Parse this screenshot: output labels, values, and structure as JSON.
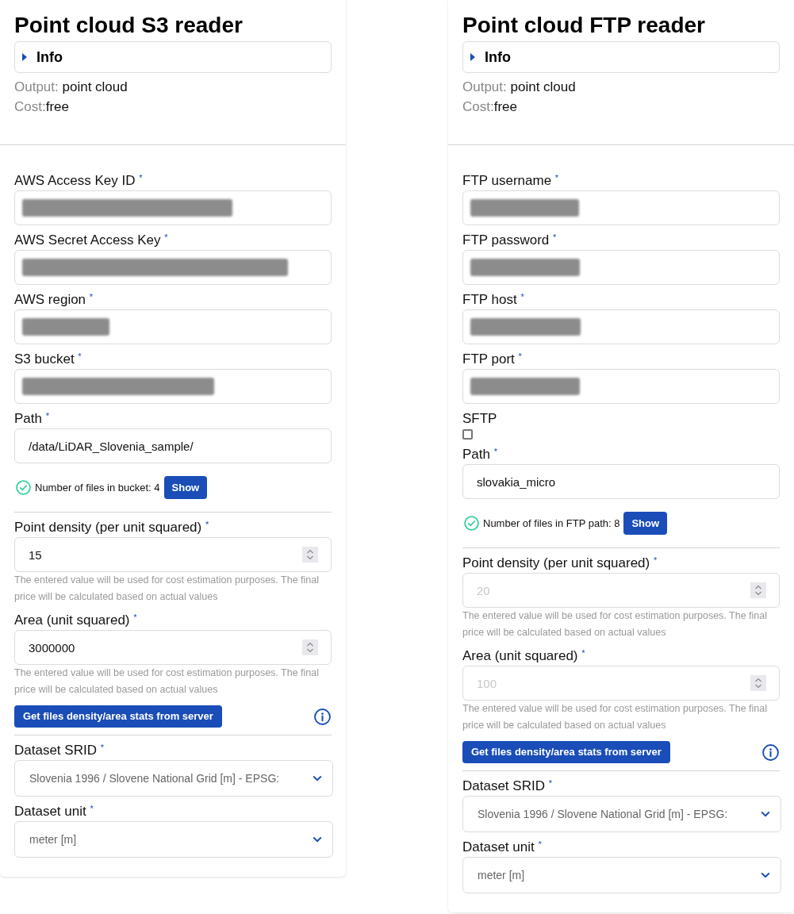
{
  "panels": [
    {
      "title": "Point cloud S3 reader",
      "info": {
        "label": "Info",
        "expanded": false
      },
      "meta": [
        {
          "label": "Output: ",
          "value": "point cloud"
        },
        {
          "label": "Cost:",
          "value": "free"
        }
      ],
      "fields": [
        {
          "kind": "text",
          "label": "AWS Access Key ID $^{*}$",
          "redacted": true
        },
        {
          "kind": "text",
          "label": "AWS Secret Access Key $^{*}$",
          "redacted": true
        },
        {
          "kind": "text",
          "label": "AWS region $^{*}$",
          "redacted": true
        },
        {
          "kind": "text",
          "label": "S3 bucket $^{*}$",
          "redacted": true
        },
        {
          "kind": "text",
          "label": "Path $^{*}$",
          "redacted": false,
          "value": "/data/LiDAR_Slovenia_sample/"
        },
        {
          "kind": "status",
          "text": "Number of files in bucket: 4",
          "button": "Show"
        },
        {
          "kind": "number",
          "label": "Point density (per unit squared) $^{*}$",
          "value": "15",
          "help": "The entered value will be used for cost estimation purposes. The final price will be calculated based on actual values"
        },
        {
          "kind": "number",
          "label": "Area (unit squared) $^{*}$",
          "value": "3000000",
          "help": "The entered value will be used for cost estimation purposes. The final price will be calculated based on actual values"
        },
        {
          "kind": "action",
          "button": "Get files density/area stats from server"
        },
        {
          "kind": "select",
          "label": "Dataset SRID $^{*}$",
          "value": "Slovenia 1996 / Slovene National Grid [m] - EPSG:"
        },
        {
          "kind": "select",
          "label": "Dataset unit $^{*}$",
          "value": "meter [m]"
        }
      ]
    },
    {
      "title": "Point cloud FTP reader",
      "info": {
        "label": "Info",
        "expanded": false
      },
      "meta": [
        {
          "label": "Output: ",
          "value": "point cloud"
        },
        {
          "label": "Cost:",
          "value": "free"
        }
      ],
      "fields": [
        {
          "kind": "text",
          "label": "FTP username $^{*}$",
          "redacted": true
        },
        {
          "kind": "text",
          "label": "FTP password $^{*}$",
          "redacted": true
        },
        {
          "kind": "text",
          "label": "FTP host $^{*}$",
          "redacted": true
        },
        {
          "kind": "text",
          "label": "FTP port $^{*}$",
          "redacted": true
        },
        {
          "kind": "checkbox",
          "label": "SFTP",
          "checked": false
        },
        {
          "kind": "text",
          "label": "Path $^{*}$",
          "redacted": false,
          "value": "slovakia_micro"
        },
        {
          "kind": "status",
          "text": "Number of files in FTP path: 8",
          "button": "Show"
        },
        {
          "kind": "number",
          "label": "Point density (per unit squared) $^{*}$",
          "placeholder": "20",
          "help": "The entered value will be used for cost estimation purposes. The final price will be calculated based on actual values"
        },
        {
          "kind": "number",
          "label": "Area (unit squared) $^{*}$",
          "placeholder": "100",
          "help": "The entered value will be used for cost estimation purposes. The final price will be calculated based on actual values"
        },
        {
          "kind": "action",
          "button": "Get files density/area stats from server"
        },
        {
          "kind": "select",
          "label": "Dataset SRID $^{*}$",
          "value": "Slovenia 1996 / Slovene National Grid [m] - EPSG:"
        },
        {
          "kind": "select",
          "label": "Dataset unit $^{*}$",
          "value": "meter [m]"
        }
      ]
    }
  ]
}
